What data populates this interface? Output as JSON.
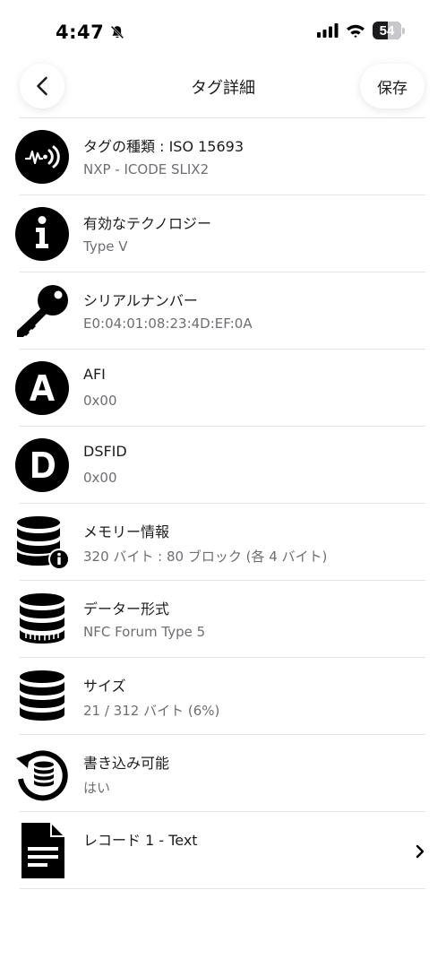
{
  "status_bar": {
    "time": "4:47",
    "battery_level": "54",
    "battery_fraction": 0.54
  },
  "nav": {
    "title": "タグ詳細",
    "save_label": "保存"
  },
  "rows": [
    {
      "title": "タグの種類 : ISO 15693",
      "subtitle": "NXP - ICODE SLIX2",
      "icon": "nfc-tag-icon"
    },
    {
      "title": "有効なテクノロジー",
      "subtitle": "Type V",
      "icon": "info-icon"
    },
    {
      "title": "シリアルナンバー",
      "subtitle": "E0:04:01:08:23:4D:EF:0A",
      "icon": "key-icon"
    },
    {
      "title": "AFI",
      "subtitle": "0x00",
      "icon": "letter-a-icon"
    },
    {
      "title": "DSFID",
      "subtitle": "0x00",
      "icon": "letter-d-icon"
    },
    {
      "title": "メモリー情報",
      "subtitle": "320 バイト : 80 ブロック (各 4 バイト)",
      "icon": "database-info-icon"
    },
    {
      "title": "データー形式",
      "subtitle": "NFC Forum Type 5",
      "icon": "database-format-icon"
    },
    {
      "title": "サイズ",
      "subtitle": "21 / 312 バイト (6%)",
      "icon": "database-size-icon"
    },
    {
      "title": "書き込み可能",
      "subtitle": "はい",
      "icon": "writable-refresh-icon"
    },
    {
      "title": "レコード 1 - Text",
      "subtitle": "",
      "icon": "document-icon"
    }
  ],
  "colors": {
    "text": "#1c1c1e",
    "subtext": "#6e6e73",
    "divider": "#e3e3e6",
    "icon": "#000000"
  }
}
